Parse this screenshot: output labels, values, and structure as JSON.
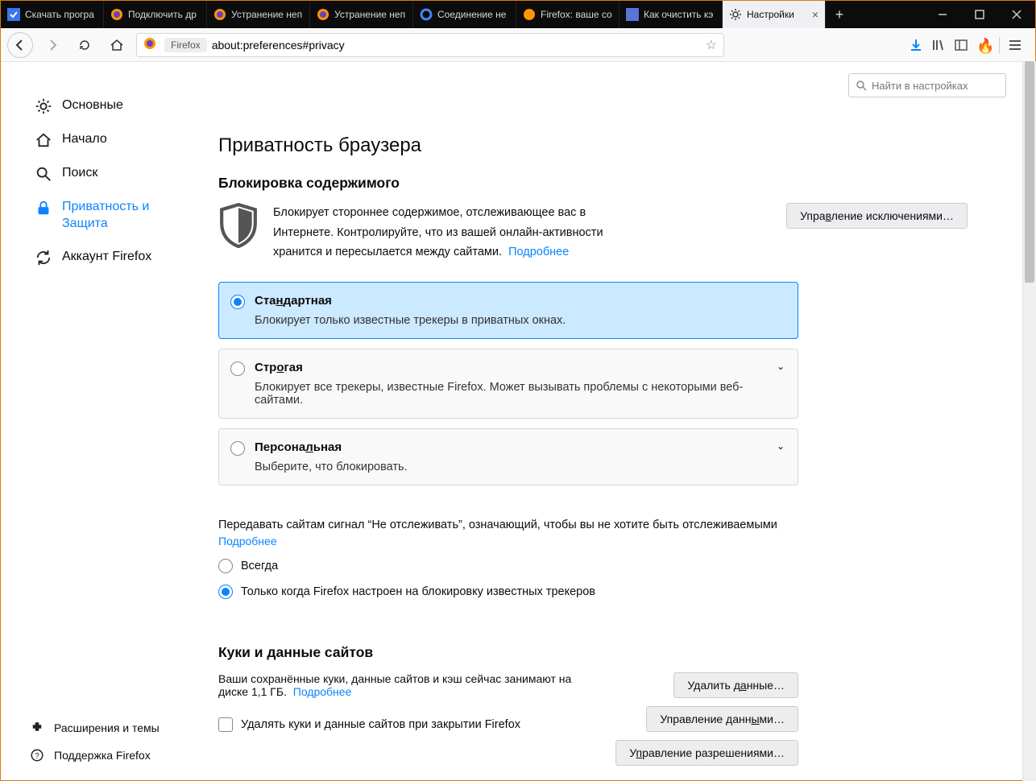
{
  "tabs": [
    {
      "label": "Скачать програ"
    },
    {
      "label": "Подключить др"
    },
    {
      "label": "Устранение неп"
    },
    {
      "label": "Устранение неп"
    },
    {
      "label": "Соединение не"
    },
    {
      "label": "Firefox: ваше со"
    },
    {
      "label": "Как очистить кэ"
    },
    {
      "label": "Настройки"
    }
  ],
  "toolbar": {
    "identity": "Firefox",
    "url": "about:preferences#privacy"
  },
  "search": {
    "placeholder": "Найти в настройках"
  },
  "sidebar": {
    "items": [
      {
        "label": "Основные"
      },
      {
        "label": "Начало"
      },
      {
        "label": "Поиск"
      },
      {
        "label": "Приватность и Защита"
      },
      {
        "label": "Аккаунт Firefox"
      }
    ],
    "footer": {
      "ext": "Расширения и темы",
      "support": "Поддержка Firefox"
    }
  },
  "main": {
    "h1": "Приватность браузера",
    "section1": {
      "title": "Блокировка содержимого",
      "intro": "Блокирует стороннее содержимое, отслеживающее вас в Интернете. Контролируйте, что из вашей онлайн-активности хранится и пересылается между сайтами.",
      "more": "Подробнее",
      "exceptions": "Управление исключениями…"
    },
    "cards": {
      "standard": {
        "title": "Стандартная",
        "desc": "Блокирует только известные трекеры в приватных окнах."
      },
      "strict": {
        "title": "Строгая",
        "desc": "Блокирует все трекеры, известные Firefox. Может вызывать проблемы с некоторыми веб-сайтами."
      },
      "custom": {
        "title": "Персональная",
        "desc": "Выберите, что блокировать."
      }
    },
    "dnt": {
      "text": "Передавать сайтам сигнал “Не отслеживать”, означающий, чтобы вы не хотите быть отслеживаемыми",
      "more": "Подробнее",
      "always": "Всегда",
      "onlywhen": "Только когда Firefox настроен на блокировку известных трекеров"
    },
    "cookies": {
      "title": "Куки и данные сайтов",
      "desc1": "Ваши сохранённые куки, данные сайтов и кэш сейчас занимают на диске 1,1 ГБ.",
      "more": "Подробнее",
      "clear_btn": "Удалить данные…",
      "manage_btn": "Управление данными…",
      "perm_btn": "Управление разрешениями…",
      "delete_on_close": "Удалять куки и данные сайтов при закрытии Firefox"
    }
  }
}
